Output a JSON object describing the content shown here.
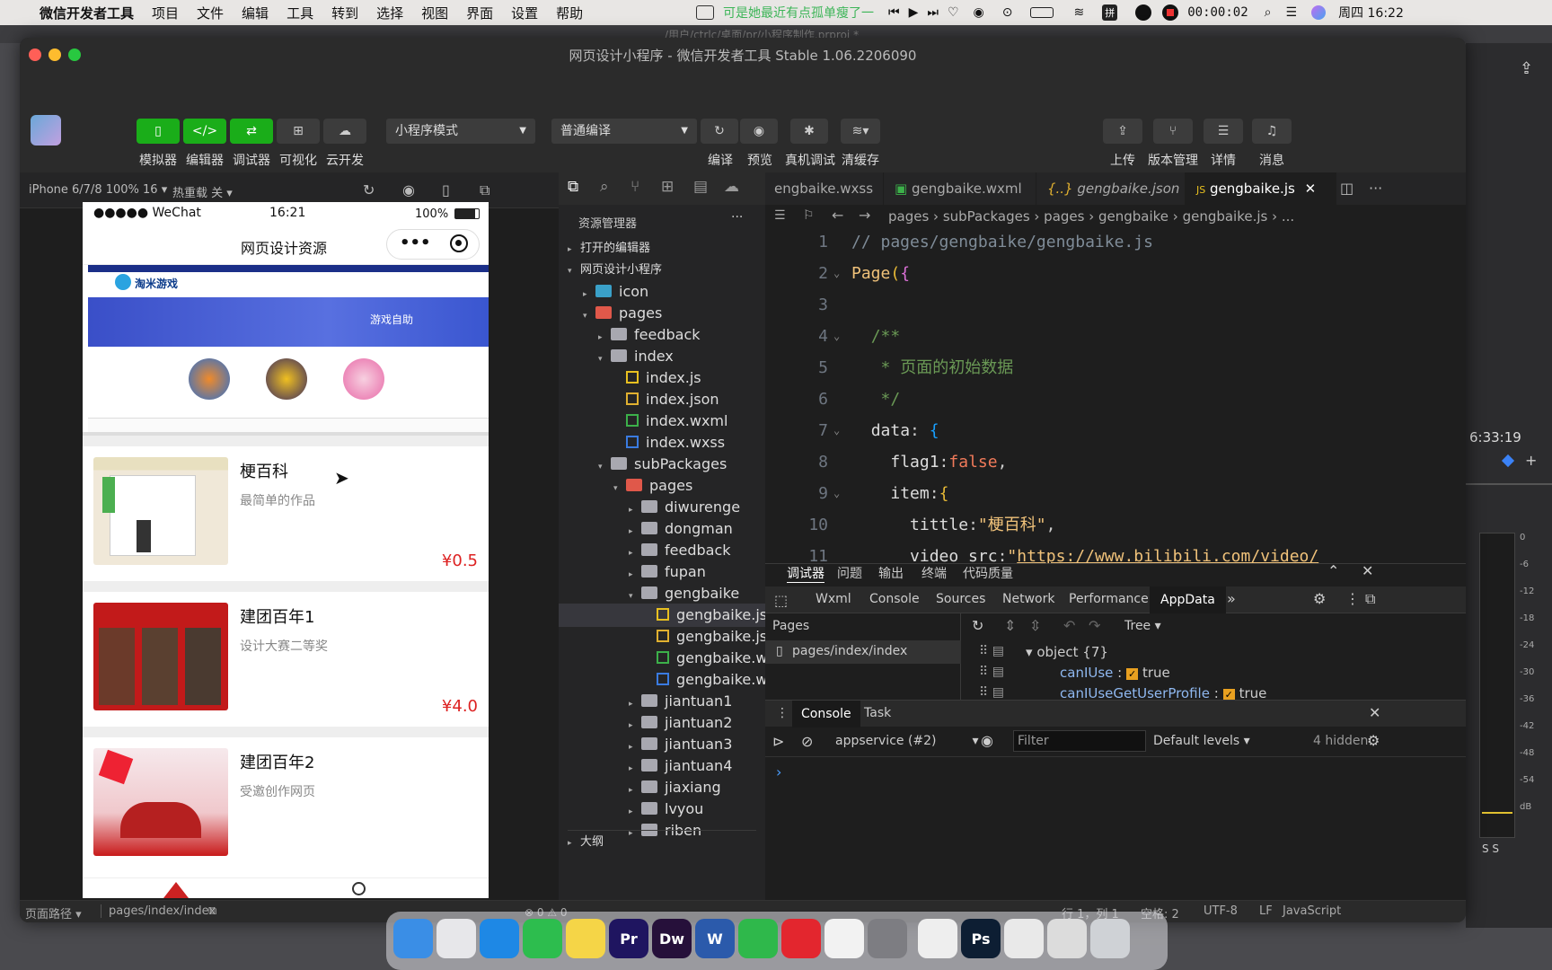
{
  "menubar": {
    "app": "微信开发者工具",
    "items": [
      "项目",
      "文件",
      "编辑",
      "工具",
      "转到",
      "选择",
      "视图",
      "界面",
      "设置",
      "帮助"
    ],
    "lyric": "可是她最近有点孤单瘦了一",
    "timer": "00:00:02",
    "clock": "周四 16:22"
  },
  "window": {
    "title": "网页设计小程序 - 微信开发者工具 Stable 1.06.2206090",
    "path_ghost": "/用户/ctrlc/桌面/pr/小程序制作.prproj *"
  },
  "toolbar": {
    "left_buttons": [
      "模拟器",
      "编辑器",
      "调试器",
      "可视化",
      "云开发"
    ],
    "mode_select": "小程序模式",
    "compile_select": "普通编译",
    "mid_buttons": [
      "编译",
      "预览",
      "真机调试",
      "清缓存"
    ],
    "right_buttons": [
      "上传",
      "版本管理",
      "详情",
      "消息"
    ]
  },
  "simulator": {
    "device": "iPhone 6/7/8 100% 16",
    "hotreload": "热重载 关",
    "status_left": "●●●●● WeChat",
    "status_time": "16:21",
    "status_battery": "100%",
    "nav_title": "网页设计资源",
    "banner_label": "游戏自助",
    "banner_logo": "淘米游戏",
    "cards": [
      {
        "title": "梗百科",
        "desc": "最简单的作品",
        "price": "¥0.5"
      },
      {
        "title": "建团百年1",
        "desc": "设计大赛二等奖",
        "price": "¥4.0"
      },
      {
        "title": "建团百年2",
        "desc": "受邀创作网页",
        "price": ""
      }
    ]
  },
  "explorer": {
    "header": "资源管理器",
    "open_editors": "打开的编辑器",
    "project": "网页设计小程序",
    "outline": "大纲",
    "tree": [
      {
        "name": "icon",
        "depth": 1,
        "type": "folder-special",
        "arrow": "▸"
      },
      {
        "name": "pages",
        "depth": 1,
        "type": "folder-red",
        "arrow": "▾"
      },
      {
        "name": "feedback",
        "depth": 2,
        "type": "folder",
        "arrow": "▸"
      },
      {
        "name": "index",
        "depth": 2,
        "type": "folder",
        "arrow": "▾"
      },
      {
        "name": "index.js",
        "depth": 3,
        "type": "js",
        "arrow": ""
      },
      {
        "name": "index.json",
        "depth": 3,
        "type": "json",
        "arrow": ""
      },
      {
        "name": "index.wxml",
        "depth": 3,
        "type": "wxml",
        "arrow": ""
      },
      {
        "name": "index.wxss",
        "depth": 3,
        "type": "wxss",
        "arrow": ""
      },
      {
        "name": "subPackages",
        "depth": 2,
        "type": "folder",
        "arrow": "▾"
      },
      {
        "name": "pages",
        "depth": 3,
        "type": "folder-red",
        "arrow": "▾"
      },
      {
        "name": "diwurenge",
        "depth": 4,
        "type": "folder",
        "arrow": "▸"
      },
      {
        "name": "dongman",
        "depth": 4,
        "type": "folder",
        "arrow": "▸"
      },
      {
        "name": "feedback",
        "depth": 4,
        "type": "folder",
        "arrow": "▸"
      },
      {
        "name": "fupan",
        "depth": 4,
        "type": "folder",
        "arrow": "▸"
      },
      {
        "name": "gengbaike",
        "depth": 4,
        "type": "folder",
        "arrow": "▾"
      },
      {
        "name": "gengbaike.js",
        "depth": 5,
        "type": "js",
        "arrow": "",
        "selected": true
      },
      {
        "name": "gengbaike.json",
        "depth": 5,
        "type": "json",
        "arrow": ""
      },
      {
        "name": "gengbaike.wxml",
        "depth": 5,
        "type": "wxml",
        "arrow": ""
      },
      {
        "name": "gengbaike.wxss",
        "depth": 5,
        "type": "wxss",
        "arrow": ""
      },
      {
        "name": "jiantuan1",
        "depth": 4,
        "type": "folder",
        "arrow": "▸"
      },
      {
        "name": "jiantuan2",
        "depth": 4,
        "type": "folder",
        "arrow": "▸"
      },
      {
        "name": "jiantuan3",
        "depth": 4,
        "type": "folder",
        "arrow": "▸"
      },
      {
        "name": "jiantuan4",
        "depth": 4,
        "type": "folder",
        "arrow": "▸"
      },
      {
        "name": "jiaxiang",
        "depth": 4,
        "type": "folder",
        "arrow": "▸"
      },
      {
        "name": "lvyou",
        "depth": 4,
        "type": "folder",
        "arrow": "▸"
      },
      {
        "name": "riben",
        "depth": 4,
        "type": "folder",
        "arrow": "▸"
      }
    ]
  },
  "editor": {
    "tabs": [
      {
        "label": "engbaike.wxss",
        "active": false,
        "italic": false
      },
      {
        "label": "gengbaike.wxml",
        "active": false,
        "italic": false
      },
      {
        "label": "gengbaike.json",
        "active": false,
        "italic": true
      },
      {
        "label": "gengbaike.js",
        "active": true,
        "italic": false
      }
    ],
    "breadcrumb": "pages › subPackages › pages › gengbaike › gengbaike.js › ...",
    "lines": [
      {
        "n": "1",
        "html": "<span style='color:#7f8c98'>// pages/gengbaike/gengbaike.js</span>"
      },
      {
        "n": "2",
        "html": "<span style='color:#f0c27a'>Page</span><span style='color:#e8ba36'>(</span><span style='color:#da70d6'>{</span>"
      },
      {
        "n": "3",
        "html": ""
      },
      {
        "n": "4",
        "html": "  <span style='color:#6a9955'>/**</span>"
      },
      {
        "n": "5",
        "html": "   <span style='color:#6a9955'>* 页面的初始数据</span>"
      },
      {
        "n": "6",
        "html": "   <span style='color:#6a9955'>*/</span>"
      },
      {
        "n": "7",
        "html": "  <span style='color:#ddd'>data</span><span style='color:#ccc'>: </span><span style='color:#179fff'>{</span>"
      },
      {
        "n": "8",
        "html": "    <span style='color:#ddd'>flag1</span><span style='color:#ccc'>:</span><span style='color:#f07a5a'>false</span><span style='color:#ccc'>,</span>"
      },
      {
        "n": "9",
        "html": "    <span style='color:#ddd'>item</span><span style='color:#ccc'>:</span><span style='color:#e8ba36'>{</span>"
      },
      {
        "n": "10",
        "html": "      <span style='color:#ddd'>tittle</span><span style='color:#ccc'>:</span><span style='color:#f0c27a'>\"梗百科\"</span><span style='color:#ccc'>,</span>"
      },
      {
        "n": "11",
        "html": "      <span style='color:#ddd'>video_src</span><span style='color:#ccc'>:</span><span style='color:#f0c27a'>\"<u>https://www.bilibili.com/video/</u></span>"
      }
    ]
  },
  "debugger": {
    "top_tabs": [
      "调试器",
      "问题",
      "输出",
      "终端",
      "代码质量"
    ],
    "dev_tabs": [
      "Wxml",
      "Console",
      "Sources",
      "Network",
      "Performance",
      "AppData"
    ],
    "pages_label": "Pages",
    "page_item": "pages/index/index",
    "view_mode": "Tree",
    "tree_root": "object {7}",
    "tree_items": [
      {
        "key": "canIUse",
        "value": "true"
      },
      {
        "key": "canIUseGetUserProfile",
        "value": "true"
      }
    ],
    "console_tabs": [
      "Console",
      "Task"
    ],
    "context": "appservice (#2)",
    "filter_placeholder": "Filter",
    "levels": "Default levels",
    "hidden": "4 hidden",
    "prompt": "›"
  },
  "statusbar": {
    "path_label": "页面路径",
    "path": "pages/index/index",
    "errors": "⊗ 0 ⚠ 0",
    "position": "行 1，列 1",
    "spaces": "空格: 2",
    "encoding": "UTF-8",
    "eol": "LF",
    "language": "JavaScript"
  },
  "background_right": {
    "timecode": "6:33:19",
    "db_scale": [
      "0",
      "-6",
      "-12",
      "-18",
      "-24",
      "-30",
      "-36",
      "-42",
      "-48",
      "-54",
      "dB"
    ],
    "ss": "S S"
  },
  "dock": {
    "apps": [
      {
        "name": "finder-icon",
        "label": "",
        "color": "#3a8ee6"
      },
      {
        "name": "launchpad-icon",
        "label": "",
        "color": "#e7e7ea"
      },
      {
        "name": "safari-icon",
        "label": "",
        "color": "#1e88e5"
      },
      {
        "name": "facetime-icon",
        "label": "",
        "color": "#2dbd4e"
      },
      {
        "name": "notes-icon",
        "label": "",
        "color": "#f5d547"
      },
      {
        "name": "premiere-icon",
        "label": "Pr",
        "color": "#1f1560"
      },
      {
        "name": "dreamweaver-icon",
        "label": "Dw",
        "color": "#26103a"
      },
      {
        "name": "word-icon",
        "label": "W",
        "color": "#2b5aab"
      },
      {
        "name": "music-icon",
        "label": "",
        "color": "#2fb84b"
      },
      {
        "name": "netease-music-icon",
        "label": "",
        "color": "#e3262e"
      },
      {
        "name": "qq-icon",
        "label": "",
        "color": "#f2f2f2"
      },
      {
        "name": "system-prefs-icon",
        "label": "",
        "color": "#7d7d82"
      },
      {
        "name": "wechat-devtools-icon",
        "label": "",
        "color": "#eeeeee"
      },
      {
        "name": "photoshop-icon",
        "label": "Ps",
        "color": "#0d1e33"
      },
      {
        "name": "wechat-icon",
        "label": "",
        "color": "#e9e9e9"
      },
      {
        "name": "preview-icon",
        "label": "",
        "color": "#dcdcdc"
      },
      {
        "name": "trash-icon",
        "label": "",
        "color": "#cfd2d6"
      }
    ]
  }
}
